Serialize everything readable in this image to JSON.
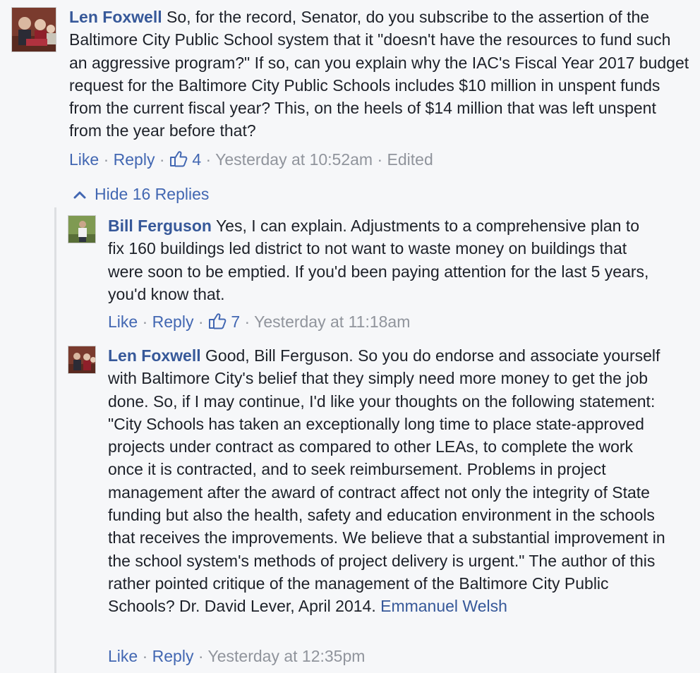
{
  "comments": [
    {
      "author": "Len Foxwell",
      "text": "So, for the record, Senator, do you subscribe to the assertion of the Baltimore City Public School system that it \"doesn't have the resources to fund such an aggressive program?\" If so, can you explain why the IAC's Fiscal Year 2017 budget request for the Baltimore City Public Schools includes $10 million in unspent funds from the current fiscal year? This, on the heels of $14 million that was left unspent from the year before that?",
      "actions": {
        "like": "Like",
        "reply": "Reply",
        "like_count": "4",
        "timestamp": "Yesterday at 10:52am",
        "edited": "Edited"
      }
    }
  ],
  "hide_replies": "Hide 16 Replies",
  "replies": [
    {
      "author": "Bill Ferguson",
      "text": "Yes, I can explain. Adjustments to a comprehensive plan to fix 160 buildings led district to not want to waste money on buildings that were soon to be emptied. If you'd been paying attention for the last 5 years, you'd know that.",
      "actions": {
        "like": "Like",
        "reply": "Reply",
        "like_count": "7",
        "timestamp": "Yesterday at 11:18am"
      }
    },
    {
      "author": "Len Foxwell",
      "text": "Good, Bill Ferguson. So you do endorse and associate yourself with Baltimore City's belief that they simply need more money to get the job done. So, if I may continue, I'd like your thoughts on the following statement: \"City Schools has taken an exceptionally long time to place state-approved projects under contract as compared to other LEAs, to complete the work once it is contracted, and to seek reimbursement. Problems in project management after the award of contract affect not only the integrity of State funding but also the health, safety and education environment in the schools that receives the improvements. We believe that a substantial improvement in the school system's methods of project delivery is urgent.\" The author of this rather pointed critique of the management of the Baltimore City Public Schools? Dr. David Lever, April 2014.",
      "mention": "Emmanuel Welsh",
      "actions": {
        "like": "Like",
        "reply": "Reply",
        "timestamp": "Yesterday at 12:35pm"
      }
    }
  ],
  "colors": {
    "link": "#365899",
    "action_link": "#4267b2",
    "meta": "#90949c",
    "text": "#1d2129",
    "background": "#f6f7f9"
  }
}
